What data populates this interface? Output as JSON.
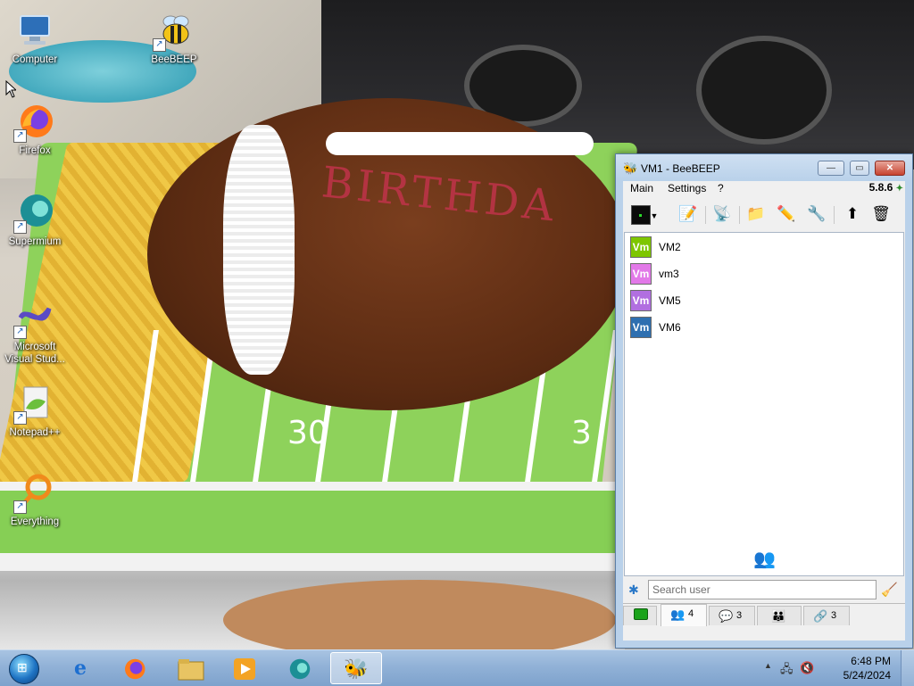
{
  "desktop": {
    "icons": [
      {
        "label": "Computer",
        "icon": "computer-icon"
      },
      {
        "label": "BeeBEEP",
        "icon": "bee-icon"
      },
      {
        "label": "Firefox",
        "icon": "firefox-icon"
      },
      {
        "label": "Supermium",
        "icon": "supermium-icon"
      },
      {
        "label": "Microsoft Visual Stud...",
        "icon": "visual-studio-icon"
      },
      {
        "label": "Notepad++",
        "icon": "notepadpp-icon"
      },
      {
        "label": "Everything",
        "icon": "everything-icon"
      }
    ],
    "wallpaper_text": {
      "cake_writing": "BIRTHDA",
      "yard_30": "30",
      "yard_3": "3"
    }
  },
  "window": {
    "title": "VM1 - BeeBEEP",
    "controls": {
      "minimize": "—",
      "maximize": "▭",
      "close": "✕"
    },
    "menu": [
      "Main",
      "Settings",
      "?"
    ],
    "version": "5.8.6",
    "toolbar_icons": [
      "status-icon",
      "vcard-icon",
      "network-icon",
      "folder-icon",
      "compose-icon",
      "tools-icon",
      "update-icon",
      "trash-icon"
    ],
    "users": [
      {
        "name": "VM2",
        "badge": "Vm",
        "color": "#7ec600"
      },
      {
        "name": "vm3",
        "badge": "Vm",
        "color": "#e279e8"
      },
      {
        "name": "VM5",
        "badge": "Vm",
        "color": "#b16fe0"
      },
      {
        "name": "VM6",
        "badge": "Vm",
        "color": "#2e6fb0"
      }
    ],
    "search": {
      "placeholder": "Search user",
      "value": ""
    },
    "tabs": [
      {
        "icon": "status-tab-icon",
        "count": ""
      },
      {
        "icon": "users-tab-icon",
        "count": "4"
      },
      {
        "icon": "chats-tab-icon",
        "count": "3"
      },
      {
        "icon": "groups-tab-icon",
        "count": ""
      },
      {
        "icon": "share-tab-icon",
        "count": "3"
      }
    ]
  },
  "taskbar": {
    "apps": [
      "internet-explorer-icon",
      "firefox-icon",
      "file-explorer-icon",
      "media-player-icon",
      "supermium-icon",
      "beebeep-icon"
    ],
    "active_app": "beebeep-icon",
    "clock": {
      "time": "6:48 PM",
      "date": "5/24/2024"
    }
  }
}
